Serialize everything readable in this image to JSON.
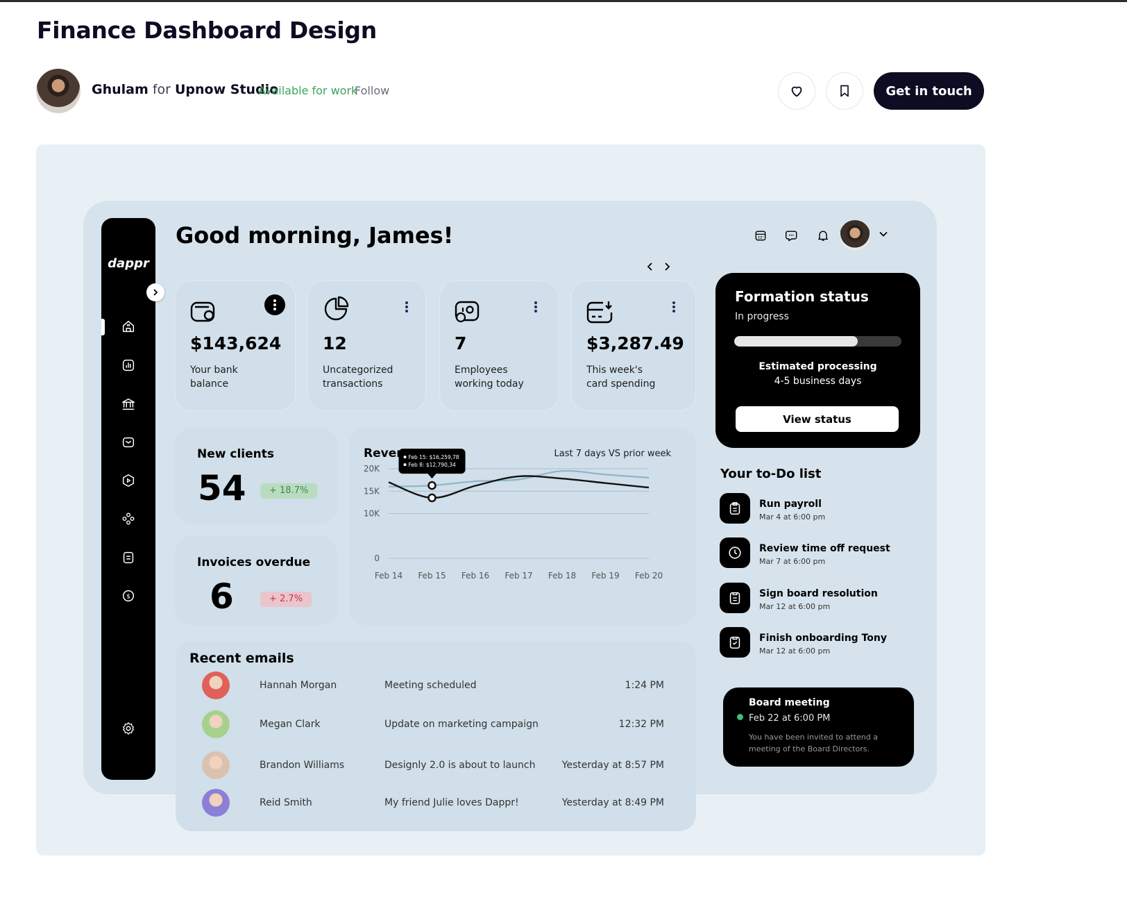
{
  "shot": {
    "title": "Finance Dashboard Design",
    "author_name": "Ghulam",
    "for_word": "for",
    "team_name": "Upnow Studio",
    "availability": "Available for work",
    "follow_label": "Follow",
    "like_icon": "heart-icon",
    "save_icon": "bookmark-icon",
    "contact_label": "Get in touch"
  },
  "dashboard": {
    "logo": "dappr",
    "greeting": "Good morning, James!",
    "sidebar_icons": [
      "home-icon",
      "chart-icon",
      "bank-icon",
      "inbox-icon",
      "video-icon",
      "team-icon",
      "document-icon",
      "money-icon",
      "settings-icon"
    ],
    "header_icons": [
      "calendar-icon",
      "chat-icon",
      "bell-icon"
    ],
    "stats": [
      {
        "value": "$143,624",
        "label": "Your bank balance",
        "icon": "wallet-icon"
      },
      {
        "value": "12",
        "label": "Uncategorized transactions",
        "icon": "pie-chart-icon"
      },
      {
        "value": "7",
        "label": "Employees working today",
        "icon": "employee-icon"
      },
      {
        "value": "$3,287.49",
        "label": "This week's card spending",
        "icon": "card-icon"
      }
    ],
    "new_clients": {
      "title": "New clients",
      "value": "54",
      "change": "+ 18.7%"
    },
    "invoices": {
      "title": "Invoices overdue",
      "value": "6",
      "change": "+ 2.7%"
    },
    "revenue": {
      "title": "Revenue",
      "period": "Last 7 days VS prior week",
      "tooltip_a": "Feb 15: $16,259,78",
      "tooltip_b": "Feb 8: $12,790,34"
    },
    "emails": {
      "title": "Recent emails",
      "rows": [
        {
          "name": "Hannah Morgan",
          "subject": "Meeting scheduled",
          "time": "1:24 PM",
          "avatar_color": "#e0605a"
        },
        {
          "name": "Megan Clark",
          "subject": "Update on marketing campaign",
          "time": "12:32 PM",
          "avatar_color": "#a8d08d"
        },
        {
          "name": "Brandon Williams",
          "subject": "Designly 2.0 is about to launch",
          "time": "Yesterday at 8:57 PM",
          "avatar_color": "#d9c2b0"
        },
        {
          "name": "Reid Smith",
          "subject": "My friend Julie loves Dappr!",
          "time": "Yesterday at 8:49 PM",
          "avatar_color": "#8c7fd6"
        }
      ]
    },
    "formation": {
      "title": "Formation status",
      "status": "In progress",
      "progress": 0.74,
      "est_line1": "Estimated processing",
      "est_line2": "4-5 business days",
      "button": "View status"
    },
    "todo": {
      "title": "Your to-Do list",
      "items": [
        {
          "name": "Run payroll",
          "date": "Mar 4 at 6:00 pm",
          "icon": "clipboard-icon"
        },
        {
          "name": "Review time off request",
          "date": "Mar 7 at 6:00 pm",
          "icon": "clock-icon"
        },
        {
          "name": "Sign board resolution",
          "date": "Mar 12 at 6:00 pm",
          "icon": "document-icon"
        },
        {
          "name": "Finish onboarding Tony",
          "date": "Mar 12 at 6:00 pm",
          "icon": "checklist-icon"
        }
      ]
    },
    "board": {
      "title": "Board meeting",
      "date": "Feb 22 at 6:00 PM",
      "desc": "You have been invited to attend a meeting of the Board Directors."
    }
  },
  "chart_data": {
    "type": "line",
    "title": "Revenue",
    "x": [
      "Feb 14",
      "Feb 15",
      "Feb 16",
      "Feb 17",
      "Feb 18",
      "Feb 19",
      "Feb 20"
    ],
    "y_ticks": [
      "0",
      "10K",
      "15K",
      "20K"
    ],
    "ylim": [
      0,
      20000
    ],
    "series": [
      {
        "values": [
          17000,
          13500,
          16200,
          18300,
          17800,
          16800,
          15800
        ],
        "color": "#111111"
      },
      {
        "values": [
          16000,
          16259.78,
          17200,
          17600,
          19500,
          18700,
          18000
        ],
        "color": "#8db5c9"
      }
    ],
    "grid": true
  }
}
